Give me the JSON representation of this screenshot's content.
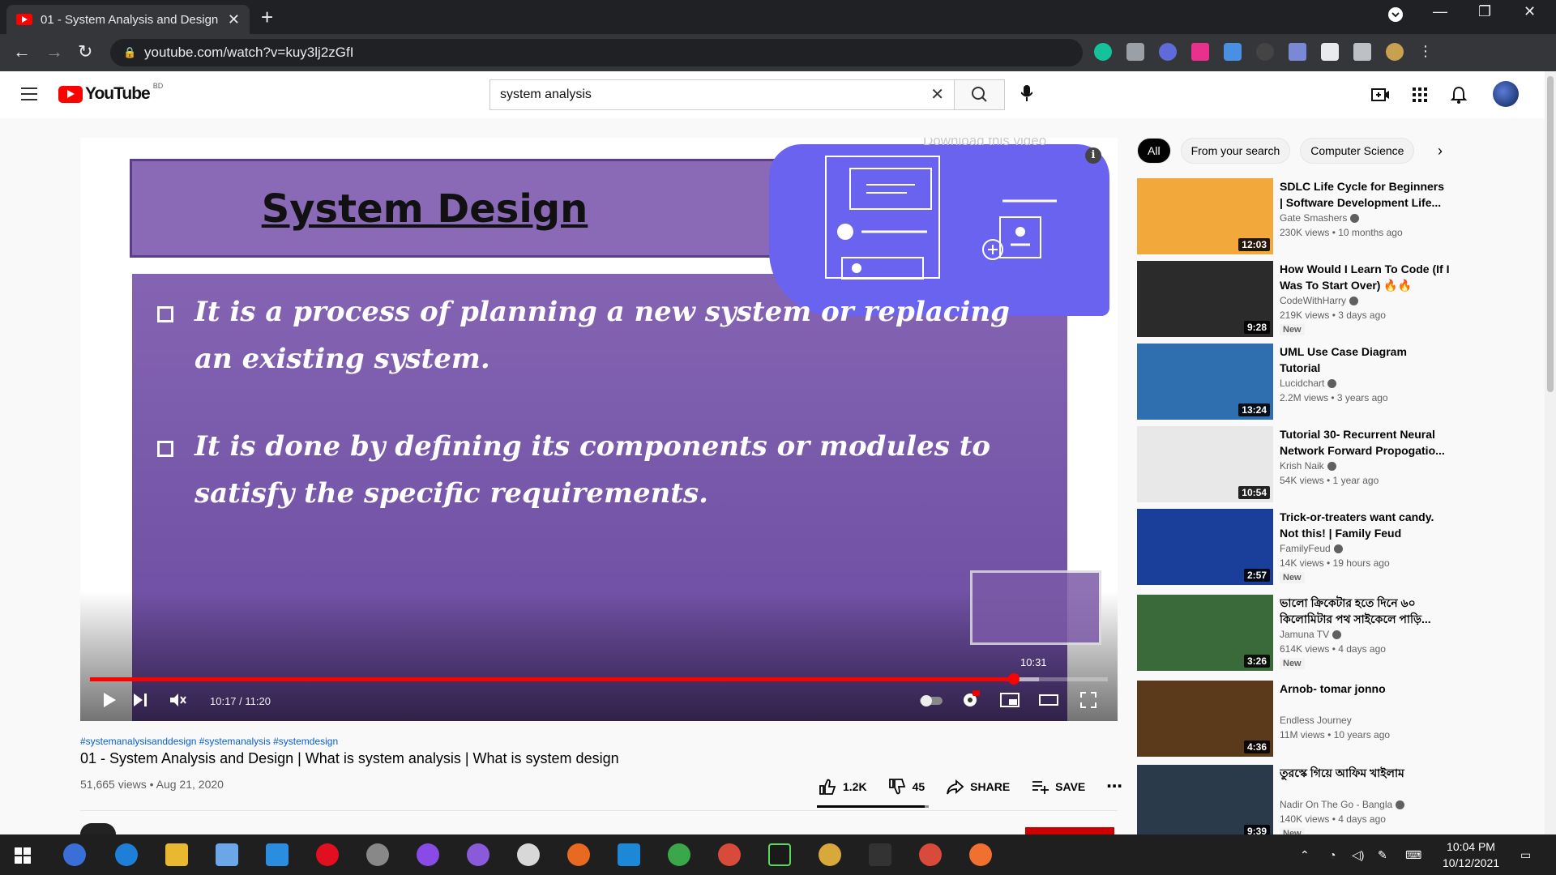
{
  "browser": {
    "tab_title": "01 - System Analysis and Design",
    "url": "youtube.com/watch?v=kuy3lj2zGfI"
  },
  "youtube": {
    "logo_text": "YouTube",
    "country_code": "BD",
    "search_value": "system analysis"
  },
  "video": {
    "slide_title": "System Design",
    "bullet1": "It is a process of planning a new system or replacing an existing system.",
    "bullet2": "It is done by defining its components or modules to satisfy the specific requirements.",
    "download_label": "Download this video",
    "preview_time": "10:31",
    "time_display": "10:17 / 11:20",
    "progress_fraction": 0.9074,
    "buffered_fraction": 0.9325
  },
  "details": {
    "hashtags": "#systemanalysisanddesign #systemanalysis #systemdesign",
    "title": "01 - System Analysis and Design | What is system analysis | What is system design",
    "meta": "51,665 views • Aug 21, 2020",
    "likes": "1.2K",
    "dislikes": "45",
    "share_label": "SHARE",
    "save_label": "SAVE",
    "like_ratio": 0.964
  },
  "chips": [
    "All",
    "From your search",
    "Computer Science"
  ],
  "recommendations": [
    {
      "title": "SDLC Life Cycle for Beginners | Software Development Life...",
      "channel": "Gate Smashers",
      "verified": true,
      "stats": "230K views • 10 months ago",
      "duration": "12:03",
      "badge": "",
      "thumb_color": "#f2a83a"
    },
    {
      "title": "How Would I Learn To Code (If I Was To Start Over) 🔥🔥",
      "channel": "CodeWithHarry",
      "verified": true,
      "stats": "219K views • 3 days ago",
      "duration": "9:28",
      "badge": "New",
      "thumb_color": "#2b2b2b"
    },
    {
      "title": "UML Use Case Diagram Tutorial",
      "channel": "Lucidchart",
      "verified": true,
      "stats": "2.2M views • 3 years ago",
      "duration": "13:24",
      "badge": "",
      "thumb_color": "#2f6fb0"
    },
    {
      "title": "Tutorial 30- Recurrent Neural Network Forward Propogatio...",
      "channel": "Krish Naik",
      "verified": true,
      "stats": "54K views • 1 year ago",
      "duration": "10:54",
      "badge": "",
      "thumb_color": "#e8e8e8"
    },
    {
      "title": "Trick-or-treaters want candy. Not this! | Family Feud",
      "channel": "FamilyFeud",
      "verified": true,
      "stats": "14K views • 19 hours ago",
      "duration": "2:57",
      "badge": "New",
      "thumb_color": "#1a3f9a"
    },
    {
      "title": "ভালো ক্রিকেটার হতে দিনে ৬০ কিলোমিটার পথ সাইকেলে পাড়ি...",
      "channel": "Jamuna TV",
      "verified": true,
      "stats": "614K views • 4 days ago",
      "duration": "3:26",
      "badge": "New",
      "thumb_color": "#3a6a3a"
    },
    {
      "title": "Arnob- tomar jonno",
      "channel": "Endless Journey",
      "verified": false,
      "stats": "11M views • 10 years ago",
      "duration": "4:36",
      "badge": "",
      "thumb_color": "#5a3a1a"
    },
    {
      "title": "তুরস্কে গিয়ে আফিম খাইলাম",
      "channel": "Nadir On The Go - Bangla",
      "verified": true,
      "stats": "140K views • 4 days ago",
      "duration": "9:39",
      "badge": "New",
      "thumb_color": "#2a3a4a"
    }
  ],
  "taskbar": {
    "time": "10:04 PM",
    "date": "10/12/2021"
  }
}
